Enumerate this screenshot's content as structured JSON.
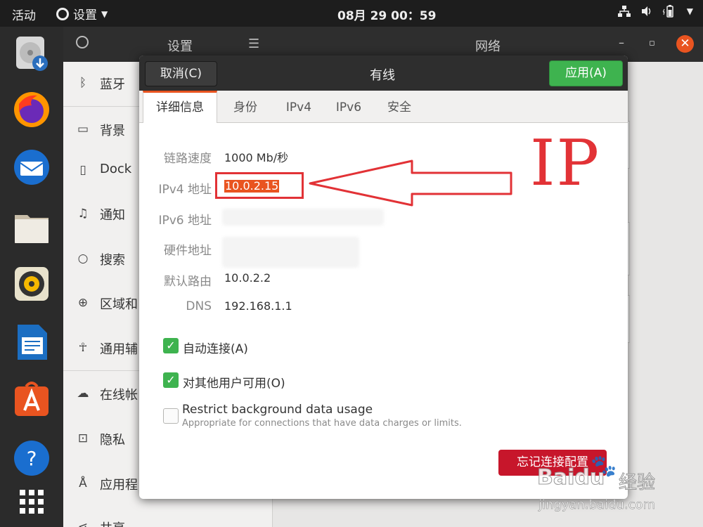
{
  "topbar": {
    "activities": "活动",
    "app_menu": "设置",
    "clock": "08月 29 00：59",
    "tray_icons": [
      "network-icon",
      "volume-icon",
      "battery-icon",
      "system-menu-icon"
    ]
  },
  "dock": {
    "apps": [
      "disk-installer-icon",
      "firefox-icon",
      "thunderbird-icon",
      "files-icon",
      "rhythmbox-icon",
      "libreoffice-writer-icon",
      "software-center-icon",
      "help-icon",
      "app-grid-icon"
    ]
  },
  "settings": {
    "sidebar_title": "设置",
    "panel_title": "网络",
    "sidebar_items": [
      {
        "label": "蓝牙",
        "icon": "bluetooth-icon"
      },
      {
        "label": "背景",
        "icon": "background-icon"
      },
      {
        "label": "Dock",
        "icon": "dock-icon"
      },
      {
        "label": "通知",
        "icon": "bell-icon"
      },
      {
        "label": "搜索",
        "icon": "search-icon"
      },
      {
        "label": "区域和",
        "icon": "globe-icon"
      },
      {
        "label": "通用辅",
        "icon": "accessibility-icon"
      },
      {
        "label": "在线帐",
        "icon": "cloud-icon"
      },
      {
        "label": "隐私",
        "icon": "lock-icon"
      },
      {
        "label": "应用程",
        "icon": "apps-icon"
      },
      {
        "label": "共享",
        "icon": "share-icon"
      }
    ]
  },
  "dialog": {
    "title": "有线",
    "cancel_label": "取消(C)",
    "apply_label": "应用(A)",
    "tabs": [
      "详细信息",
      "身份",
      "IPv4",
      "IPv6",
      "安全"
    ],
    "details": {
      "link_speed_label": "链路速度",
      "link_speed_value": "1000 Mb/秒",
      "ipv4_label": "IPv4 地址",
      "ipv4_value": "10.0.2.15",
      "ipv6_label": "IPv6 地址",
      "hw_label": "硬件地址",
      "route_label": "默认路由",
      "route_value": "10.0.2.2",
      "dns_label": "DNS",
      "dns_value": "192.168.1.1"
    },
    "auto_connect_label": "自动连接(A)",
    "auto_connect_checked": true,
    "others_label": "对其他用户可用(O)",
    "others_checked": true,
    "restrict_label": "Restrict background data usage",
    "restrict_desc": "Appropriate for connections that have data charges or limits.",
    "restrict_checked": false,
    "forget_label": "忘记连接配置"
  },
  "annotation": {
    "text": "IP",
    "color": "#e23236"
  },
  "watermark": {
    "brand": "Baidu",
    "suffix": "经验",
    "url": "jingyan.baidu.com"
  },
  "colors": {
    "accent": "#e95420",
    "apply_green": "#3eb34f",
    "forget_red": "#c7162b"
  }
}
